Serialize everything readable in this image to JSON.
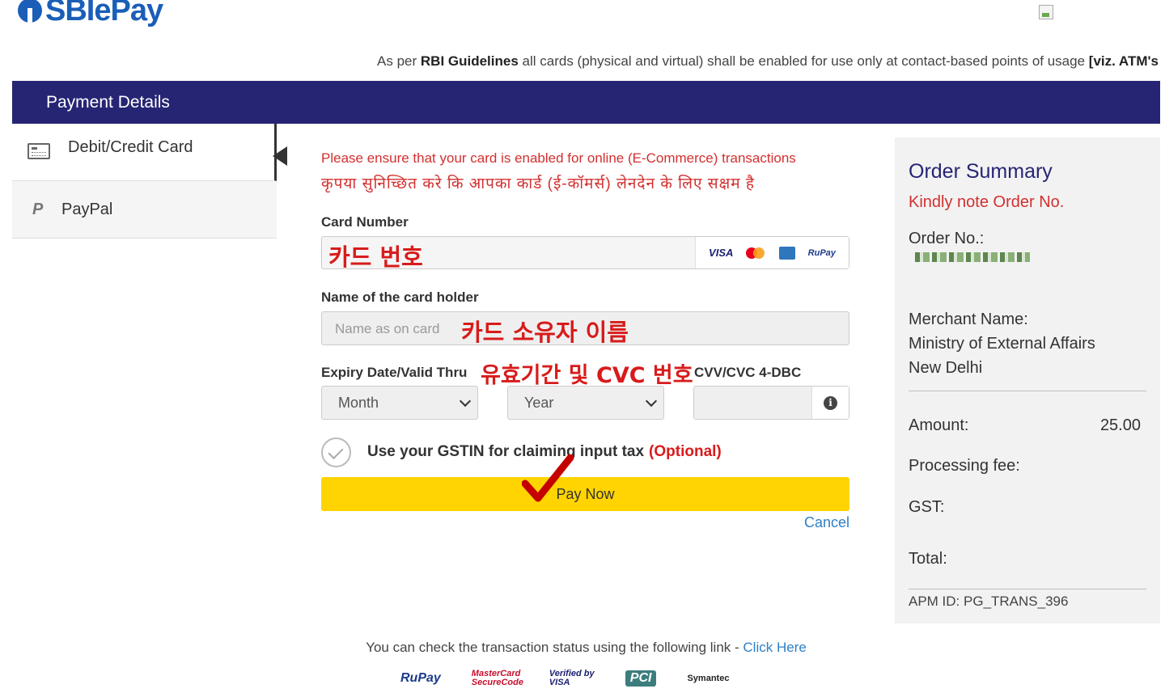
{
  "brand": {
    "logo_text": "SBIePay",
    "accent": "#1a5eb8"
  },
  "notice": {
    "prefix": "As per ",
    "bold": "RBI Guidelines",
    "middle": " all cards (physical and virtual) shall be enabled for use only at contact-based points of usage ",
    "bold_end": "[viz. ATM's"
  },
  "header": {
    "title": "Payment Details",
    "bg": "#262574"
  },
  "sidebar": {
    "items": [
      {
        "label": "Debit/Credit Card",
        "icon": "credit-card-icon",
        "active": true
      },
      {
        "label": "PayPal",
        "icon": "paypal-icon",
        "active": false
      }
    ]
  },
  "form": {
    "warning_en": "Please ensure that your card is enabled for online (E-Commerce) transactions",
    "warning_hi": "कृपया सुनिच्छित करे कि आपका कार्ड (ई-कॉमर्स) लेनदेन के लिए सक्षम है",
    "card_number_label": "Card Number",
    "card_number_overlay": "카드 번호",
    "card_logos": [
      "VISA",
      "mastercard",
      "amex",
      "RuPay"
    ],
    "holder_label": "Name of the card holder",
    "holder_placeholder": "Name as on card",
    "holder_overlay": "카드 소유자 이름",
    "expiry_label": "Expiry Date/Valid Thru",
    "expiry_overlay": "유효기간 및 CVC 번호",
    "cvv_label": "CVV/CVC 4-DBC",
    "month_value": "Month",
    "year_value": "Year",
    "gst_text": "Use your GSTIN for claiming input tax",
    "gst_optional": "(Optional)",
    "pay_label": "Pay Now",
    "cancel_label": "Cancel",
    "pay_color": "#ffd400"
  },
  "summary": {
    "title": "Order Summary",
    "note": "Kindly note Order No.",
    "order_no_label": "Order No.:",
    "merchant_label": "Merchant Name:",
    "merchant_name_1": "Ministry of External Affairs",
    "merchant_name_2": "New Delhi",
    "amount_label": "Amount:",
    "amount_value": "25.00",
    "processing_label": "Processing fee:",
    "gst_label": "GST:",
    "total_label": "Total:",
    "apm": "APM ID: PG_TRANS_396"
  },
  "footer": {
    "status_text": "You can check the transaction status using the following link - ",
    "status_link": "Click Here",
    "trust_logos": [
      "RuPay",
      "MasterCard SecureCode",
      "Verified by VISA",
      "PCI",
      "Symantec"
    ]
  }
}
